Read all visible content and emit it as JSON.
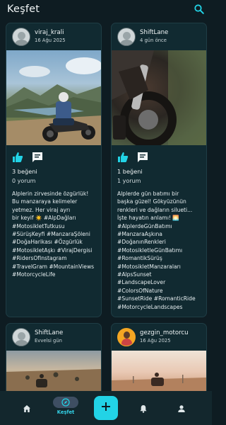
{
  "header": {
    "title": "Keşfet",
    "search_icon": "search-icon"
  },
  "colors": {
    "background": "#0e1c22",
    "card": "#112a31",
    "accent": "#22d3e6",
    "nav_pill": "#3e4e62"
  },
  "posts": [
    {
      "username": "viraj_krali",
      "date": "16 Ağu 2025",
      "likes": "3 beğeni",
      "comments": "0 yorum",
      "caption": "Alplerin zirvesinde özgürlük!\nBu manzaraya kelimeler\nyetmez. Her viraj ayrı\nbir keyif ☀️ #AlpDağları\n#MotosikletTutkusu\n#SürüşKeyfi #ManzaraŞöleni\n#DoğaHarikası #Özgürlük\n#MotosikletAşkı #VirajDergisi\n#RidersOfInstagram\n#TravelGram #MountainViews\n#MotorcycleLife"
    },
    {
      "username": "ShiftLane",
      "date": "4 gün önce",
      "likes": "1 beğeni",
      "comments": "1 yorum",
      "caption": "Alplerde gün batımı bir\nbaşka güzel! Gökyüzünün\nrenkleri ve dağların silueti...\nİşte hayatın anlamı! 🌅\n#AlplerdeGünBatımı\n#ManzaraAşkına\n#DoğanınRenkleri\n#MotosikletleGünBatımı\n#RomantikSürüş\n#MotosikletManzaraları\n#AlpsSunset\n#LandscapeLover\n#ColorsOfNature\n#SunsetRide #RomanticRide\n#MotorcycleLandscapes"
    },
    {
      "username": "ShiftLane",
      "date": "Evvelsi gün"
    },
    {
      "username": "gezgin_motorcu",
      "date": "16 Ağu 2025"
    }
  ],
  "bottom_nav": {
    "explore_label": "Keşfet",
    "items": [
      "home-icon",
      "explore-icon",
      "add-icon",
      "notification-icon",
      "profile-icon"
    ]
  }
}
